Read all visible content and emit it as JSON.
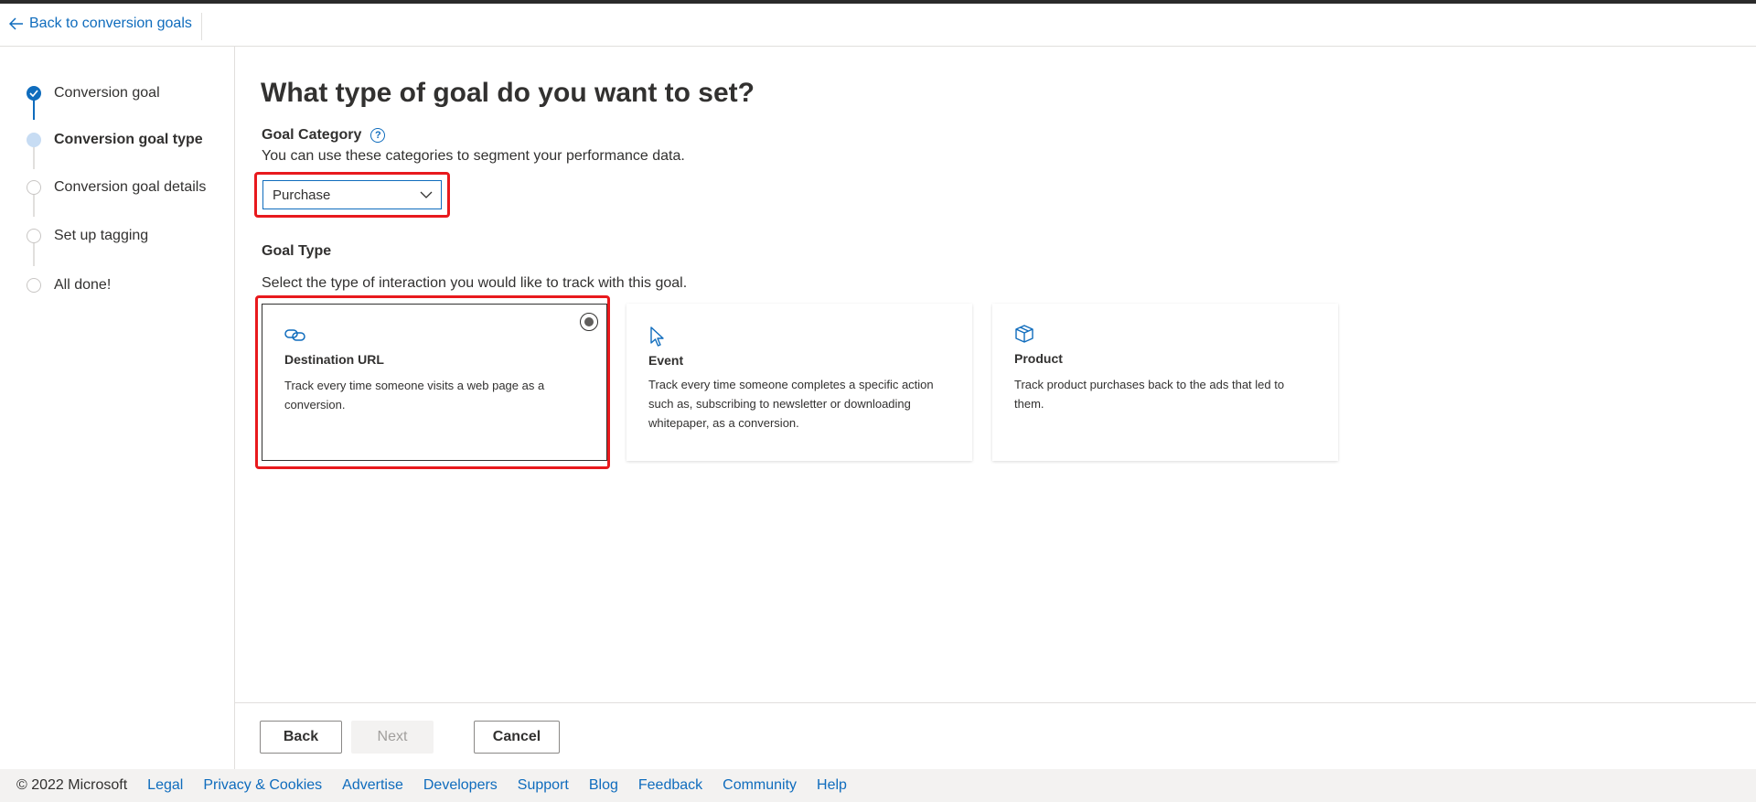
{
  "header": {
    "back_label": "Back to conversion goals"
  },
  "steps": [
    {
      "label": "Conversion goal",
      "state": "done"
    },
    {
      "label": "Conversion goal type",
      "state": "current"
    },
    {
      "label": "Conversion goal details",
      "state": "todo"
    },
    {
      "label": "Set up tagging",
      "state": "todo"
    },
    {
      "label": "All done!",
      "state": "todo"
    }
  ],
  "main": {
    "title": "What type of goal do you want to set?",
    "category_label": "Goal Category",
    "category_desc": "You can use these categories to segment your performance data.",
    "category_value": "Purchase",
    "type_label": "Goal Type",
    "type_desc": "Select the type of interaction you would like to track with this goal.",
    "cards": [
      {
        "icon": "link-icon",
        "title": "Destination URL",
        "desc": "Track every time someone visits a web page as a conversion.",
        "selected": true
      },
      {
        "icon": "cursor-icon",
        "title": "Event",
        "desc": "Track every time someone completes a specific action such as, subscribing to newsletter or downloading whitepaper, as a conversion.",
        "selected": false
      },
      {
        "icon": "box-icon",
        "title": "Product",
        "desc": "Track product purchases back to the ads that led to them.",
        "selected": false
      }
    ]
  },
  "actions": {
    "back": "Back",
    "next": "Next",
    "cancel": "Cancel"
  },
  "footer": {
    "copyright": "© 2022 Microsoft",
    "links": [
      "Legal",
      "Privacy & Cookies",
      "Advertise",
      "Developers",
      "Support",
      "Blog",
      "Feedback",
      "Community",
      "Help"
    ]
  },
  "colors": {
    "accent": "#0f6cbd",
    "highlight": "#e8191d",
    "footer_bg": "#f3f2f1"
  }
}
